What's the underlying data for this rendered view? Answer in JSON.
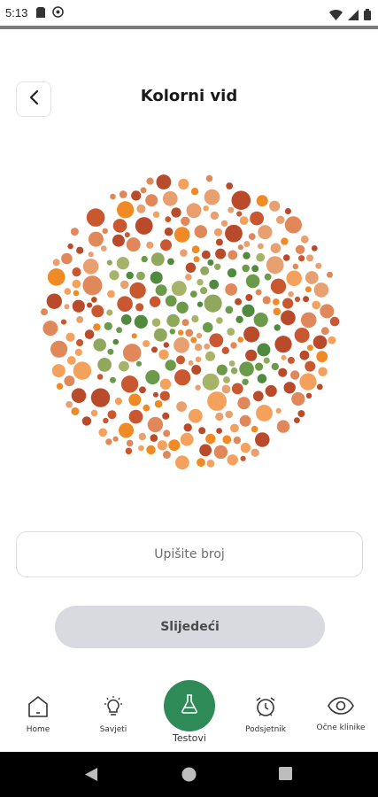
{
  "status_bar": {
    "time": "5:13",
    "icons": [
      "sd-card-icon",
      "no-disturb-icon",
      "wifi-icon",
      "signal-icon",
      "battery-icon"
    ]
  },
  "header": {
    "back_icon": "chevron-left-icon",
    "title": "Kolorni vid"
  },
  "plate": {
    "description_colors": {
      "background_dots": [
        "#e0885a",
        "#c9572f",
        "#f08a24",
        "#e8a070",
        "#b94a2a",
        "#f3a15c"
      ],
      "figure_dots": [
        "#6b9b4a",
        "#a8b36a",
        "#4f8a3f",
        "#8fa85c"
      ]
    }
  },
  "input": {
    "placeholder": "Upišite broj",
    "value": ""
  },
  "next_button": {
    "label": "Slijedeći"
  },
  "bottom_nav": {
    "items": [
      {
        "label": "Home",
        "icon": "home-icon"
      },
      {
        "label": "Savjeti",
        "icon": "lightbulb-icon"
      },
      {
        "label": "Testovi",
        "icon": "flask-icon",
        "active": true
      },
      {
        "label": "Podsjetnik",
        "icon": "alarm-clock-icon"
      },
      {
        "label": "Očne klinike",
        "icon": "eye-icon"
      }
    ],
    "active_color": "#2e8b57"
  },
  "android_nav": {
    "icons": [
      "back-triangle-icon",
      "home-circle-icon",
      "recents-square-icon"
    ]
  }
}
